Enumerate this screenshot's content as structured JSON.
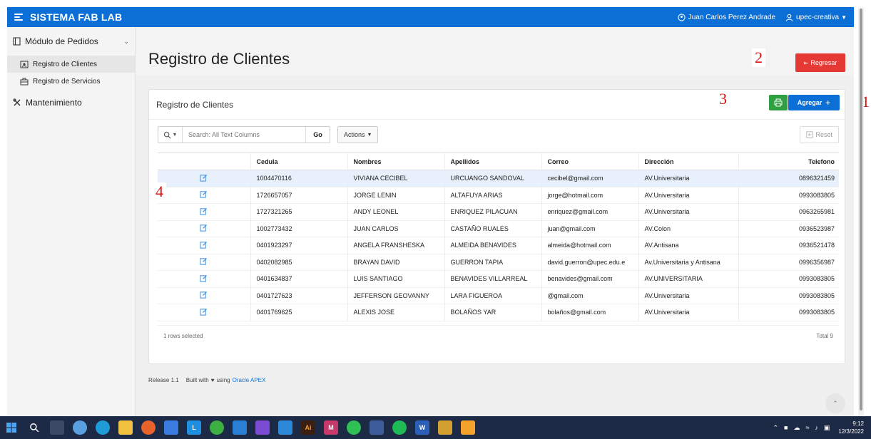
{
  "app": {
    "title": "SISTEMA FAB LAB",
    "user_name": "Juan Carlos Perez Andrade",
    "workspace": "upec-creativa"
  },
  "sidebar": {
    "groups": [
      {
        "label": "Módulo de Pedidos",
        "items": [
          {
            "label": "Registro de Clientes"
          },
          {
            "label": "Registro de Servicios"
          }
        ]
      },
      {
        "label": "Mantenimiento"
      }
    ]
  },
  "page": {
    "title": "Registro de Clientes",
    "back_label": "Regresar"
  },
  "region": {
    "title": "Registro de Clientes",
    "add_label": "Agregar"
  },
  "toolbar": {
    "search_placeholder": "Search: All Text Columns",
    "go_label": "Go",
    "actions_label": "Actions",
    "reset_label": "Reset"
  },
  "table": {
    "columns": [
      "",
      "Cedula",
      "Nombres",
      "Apellidos",
      "Correo",
      "Dirección",
      "Telefono"
    ],
    "rows": [
      [
        "1004470116",
        "VIVIANA CECIBEL",
        "URCUANGO SANDOVAL",
        "cecibel@gmail.com",
        "AV.Universitaria",
        "0896321459"
      ],
      [
        "1726657057",
        "JORGE LENIN",
        "ALTAFUYA ARIAS",
        "jorge@hotmail.com",
        "AV.Universitaria",
        "0993083805"
      ],
      [
        "1727321265",
        "ANDY LEONEL",
        "ENRIQUEZ PILACUAN",
        "enriquez@gmail.com",
        "AV.Universitaria",
        "0963265981"
      ],
      [
        "1002773432",
        "JUAN CARLOS",
        "CASTAÑO RUALES",
        "juan@gmail.com",
        "AV.Colon",
        "0936523987"
      ],
      [
        "0401923297",
        "ANGELA FRANSHESKA",
        "ALMEIDA BENAVIDES",
        "almeida@hotmail.com",
        "AV.Antisana",
        "0936521478"
      ],
      [
        "0402082985",
        "BRAYAN DAVID",
        "GUERRON TAPIA",
        "david.guerron@upec.edu.e",
        "Av.Universitaria y Antisana",
        "0996356987"
      ],
      [
        "0401634837",
        "LUIS SANTIAGO",
        "BENAVIDES VILLARREAL",
        "benavides@gmail.com",
        "AV.UNIVERSITARIA",
        "0993083805"
      ],
      [
        "0401727623",
        "JEFFERSON GEOVANNY",
        "LARA FIGUEROA",
        "@gmail.com",
        "AV.Universitaria",
        "0993083805"
      ],
      [
        "0401769625",
        "ALEXIS JOSE",
        "BOLAÑOS YAR",
        "bolaños@gmail.com",
        "AV.Universitaria",
        "0993083805"
      ]
    ],
    "selected_text": "1 rows selected",
    "total_text": "Total 9"
  },
  "annotations": [
    "1",
    "2",
    "3",
    "4"
  ],
  "footer": {
    "release": "Release 1.1",
    "built_with": "Built with",
    "using": "using",
    "link": "Oracle APEX"
  },
  "taskbar": {
    "time": "9:12",
    "date": "12/3/2022"
  },
  "colors": {
    "topbar": "#0b6fd6",
    "danger": "#e53935",
    "success": "#2ea043",
    "selected_row": "#e8f1fb",
    "annotation": "#dd1111"
  },
  "icons": [
    "menu-icon",
    "user-icon",
    "module-icon",
    "clients-icon",
    "services-icon",
    "tools-icon",
    "print-icon",
    "edit-icon",
    "search-icon",
    "reset-icon",
    "heart-icon"
  ]
}
